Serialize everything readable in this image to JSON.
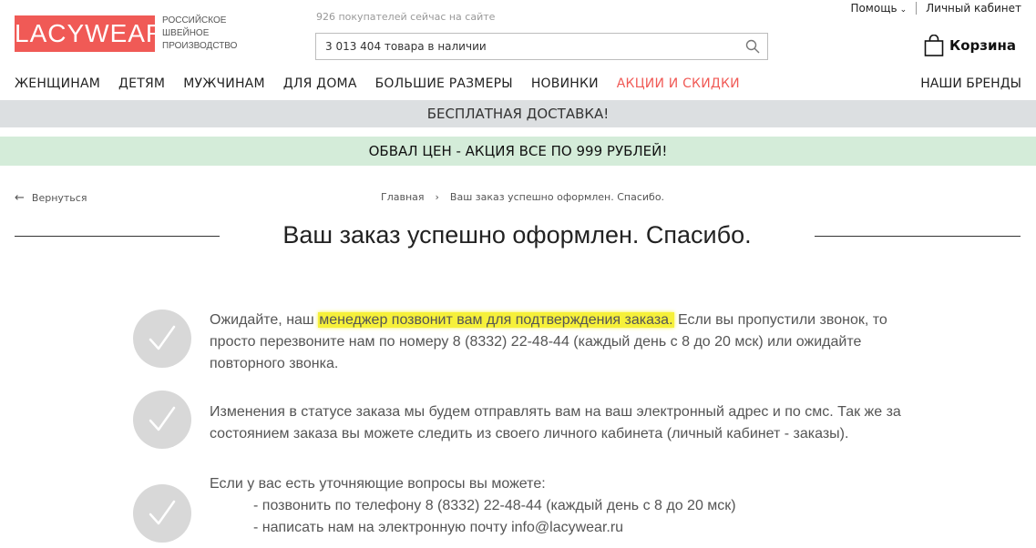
{
  "header": {
    "logo": "LACYWEAR",
    "logo_caption": [
      "РОССИЙСКОЕ",
      "ШВЕЙНОЕ",
      "ПРОИЗВОДСТВО"
    ],
    "online_text": "926 покупателей сейчас на сайте",
    "search_placeholder": "3 013 404 товара в наличии",
    "help_label": "Помощь",
    "account_label": "Личный кабинет",
    "cart_label": "Корзина"
  },
  "nav": {
    "items": [
      "ЖЕНЩИНАМ",
      "ДЕТЯМ",
      "МУЖЧИНАМ",
      "ДЛЯ ДОМА",
      "БОЛЬШИЕ РАЗМЕРЫ",
      "НОВИНКИ",
      "АКЦИИ И СКИДКИ"
    ],
    "brands": "НАШИ БРЕНДЫ",
    "sale_color": "#f05a56"
  },
  "banners": {
    "delivery": "БЕСПЛАТНАЯ ДОСТАВКА!",
    "promo": "ОБВАЛ ЦЕН - АКЦИЯ ВСЕ ПО 999 РУБЛЕЙ!"
  },
  "breadcrumb": {
    "back": "Вернуться",
    "home": "Главная",
    "current": "Ваш заказ успешно оформлен. Спасибо."
  },
  "page": {
    "title": "Ваш заказ успешно оформлен. Спасибо.",
    "msg1_before": "Ожидайте, наш ",
    "msg1_highlight": "менеджер позвонит вам для подтверждения заказа.",
    "msg1_after": " Если вы пропустили звонок, то просто перезвоните нам по номеру 8 (8332) 22-48-44 (каждый день с 8 до 20 мск) или ожидайте повторного звонка.",
    "msg2": "Изменения в статусе заказа мы будем отправлять вам на ваш электронный адрес и по смс. Так же за состоянием заказа вы можете следить из своего личного кабинета (личный кабинет - заказы).",
    "msg3_intro": "Если у вас есть уточняющие вопросы вы можете:",
    "msg3_line1": "- позвонить по телефону 8 (8332) 22-48-44 (каждый день с 8 до 20 мск)",
    "msg3_line2": "- написать нам на электронную почту info@lacywear.ru"
  },
  "colors": {
    "brand": "#f05a56",
    "highlight": "#f6f03a",
    "band_gray": "#dcdfe1",
    "band_green": "#d4ecd9"
  }
}
